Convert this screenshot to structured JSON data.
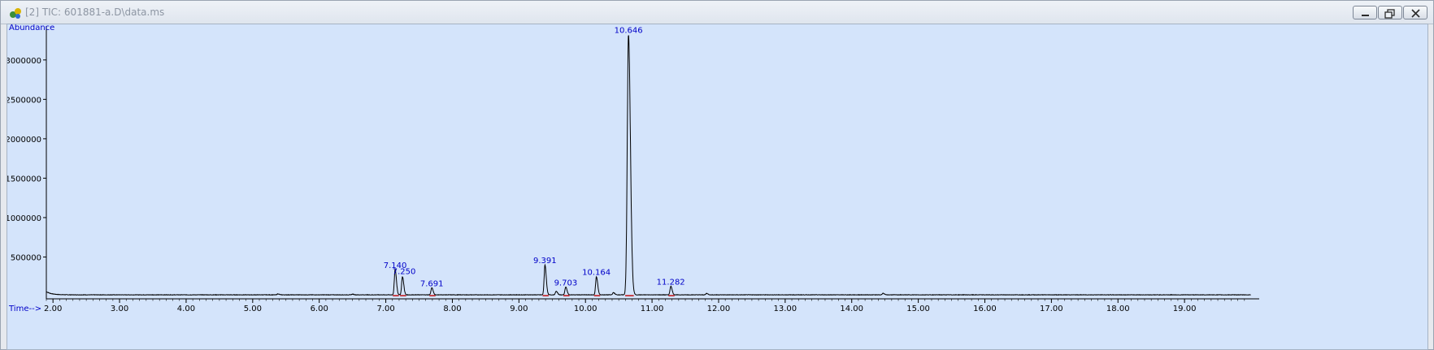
{
  "window": {
    "title": "[2] TIC: 601881-a.D\\data.ms",
    "buttons": [
      "minimize",
      "restore",
      "close"
    ]
  },
  "colors": {
    "plot_background": "#d4e4fb",
    "trace": "#000000",
    "label_text": "#0000c8",
    "baseline_marker": "#c00000"
  },
  "chart_data": {
    "type": "line",
    "xlabel": "Time-->",
    "ylabel": "Abundance",
    "xlim": [
      1.9,
      20.0
    ],
    "ylim": [
      0,
      3400000
    ],
    "x_ticks": [
      "2.00",
      "3.00",
      "4.00",
      "5.00",
      "6.00",
      "7.00",
      "8.00",
      "9.00",
      "10.00",
      "11.00",
      "12.00",
      "13.00",
      "14.00",
      "15.00",
      "16.00",
      "17.00",
      "18.00",
      "19.00"
    ],
    "y_ticks": [
      "500000",
      "1000000",
      "1500000",
      "2000000",
      "2500000",
      "3000000"
    ],
    "grid": false,
    "peaks": [
      {
        "label": "7.140",
        "rt": 7.14,
        "height": 320000
      },
      {
        "label": "7.250",
        "rt": 7.25,
        "height": 230000
      },
      {
        "label": "7.691",
        "rt": 7.691,
        "height": 90000
      },
      {
        "label": "9.391",
        "rt": 9.391,
        "height": 380000
      },
      {
        "label": "9.703",
        "rt": 9.703,
        "height": 100000
      },
      {
        "label": "10.164",
        "rt": 10.164,
        "height": 230000
      },
      {
        "label": "10.646",
        "rt": 10.646,
        "height": 3300000
      },
      {
        "label": "11.282",
        "rt": 11.282,
        "height": 110000
      }
    ],
    "minor_peaks": [
      {
        "rt": 5.38,
        "height": 12000
      },
      {
        "rt": 6.5,
        "height": 9000
      },
      {
        "rt": 9.56,
        "height": 45000
      },
      {
        "rt": 10.42,
        "height": 28000
      },
      {
        "rt": 11.82,
        "height": 18000
      },
      {
        "rt": 14.47,
        "height": 20000
      }
    ],
    "baseline_level": 20000
  }
}
